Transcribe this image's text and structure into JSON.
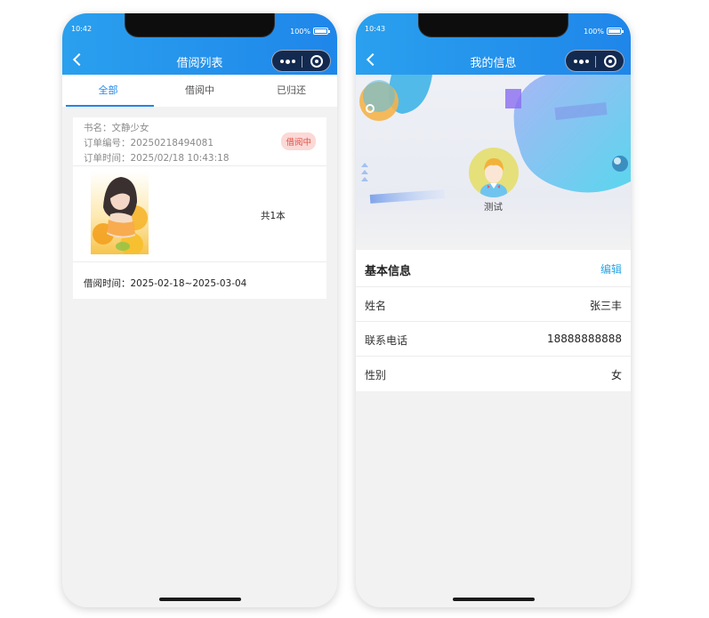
{
  "status_bar": {
    "left_time": "10:42",
    "right_time": "10:43",
    "battery": "100%"
  },
  "borrow_list": {
    "title": "借阅列表",
    "tabs": [
      {
        "label": "全部",
        "active": true
      },
      {
        "label": "借阅中",
        "active": false
      },
      {
        "label": "已归还",
        "active": false
      }
    ],
    "order": {
      "book_name": "书名：文静少女",
      "order_no": "订单编号：20250218494081",
      "order_time": "订单时间：2025/02/18 10:43:18",
      "status": "借阅中",
      "count": "共1本",
      "borrow_period": "借阅时间：2025-02-18~2025-03-04"
    }
  },
  "my_info": {
    "title": "我的信息",
    "username": "测试",
    "section_title": "基本信息",
    "edit_label": "编辑",
    "fields": [
      {
        "label": "姓名",
        "value": "张三丰"
      },
      {
        "label": "联系电话",
        "value": "18888888888"
      },
      {
        "label": "性别",
        "value": "女"
      }
    ]
  },
  "colors": {
    "header_gradient_start": "#2aa0ee",
    "header_gradient_end": "#1f86ea",
    "accent": "#1f86ea",
    "edit_link": "#29a6e6",
    "badge_bg": "#fbd9d6",
    "badge_text": "#e0544c"
  },
  "icons": [
    "back-chevron-icon",
    "more-dots-icon",
    "close-target-icon",
    "battery-icon"
  ]
}
